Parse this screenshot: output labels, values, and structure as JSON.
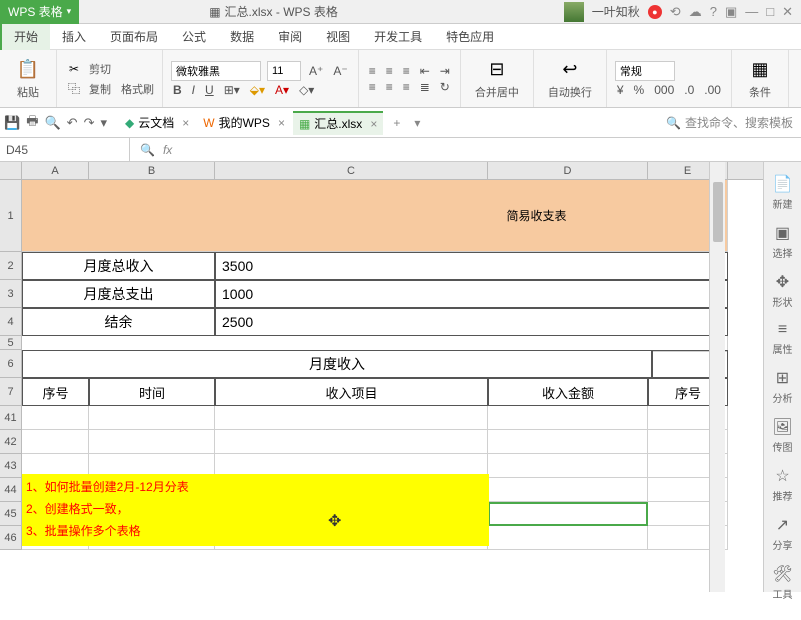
{
  "titlebar": {
    "app": "WPS 表格",
    "doc": "汇总.xlsx - WPS 表格",
    "user": "一叶知秋"
  },
  "menu": [
    "开始",
    "插入",
    "页面布局",
    "公式",
    "数据",
    "审阅",
    "视图",
    "开发工具",
    "特色应用"
  ],
  "ribbon": {
    "paste": "粘贴",
    "cut": "剪切",
    "copy": "复制",
    "format_painter": "格式刷",
    "font": "微软雅黑",
    "size": "11",
    "merge": "合并居中",
    "wrap": "自动换行",
    "num_format": "常规",
    "cond": "条件"
  },
  "tabs": {
    "cloud": "云文档",
    "my": "我的WPS",
    "file": "汇总.xlsx",
    "search": "查找命令、搜索模板"
  },
  "fx": {
    "name": "D45"
  },
  "cols": [
    "A",
    "B",
    "C",
    "D",
    "E"
  ],
  "sheet": {
    "title": "简易收支表",
    "r2_label": "月度总收入",
    "r2_val": "3500",
    "r3_label": "月度总支出",
    "r3_val": "1000",
    "r4_label": "结余",
    "r4_val": "2500",
    "r6": "月度收入",
    "h7": {
      "a": "序号",
      "b": "时间",
      "c": "收入项目",
      "d": "收入金额",
      "e": "序号"
    }
  },
  "rows_left": [
    "1",
    "2",
    "3",
    "4",
    "5",
    "6",
    "7",
    "41",
    "42",
    "43",
    "44",
    "45",
    "46"
  ],
  "note": {
    "l1": "1、如何批量创建2月-12月分表",
    "l2": "2、创建格式一致，",
    "l3": "3、批量操作多个表格"
  },
  "rpane": [
    {
      "ico": "📄",
      "t": "新建"
    },
    {
      "ico": "▣",
      "t": "选择"
    },
    {
      "ico": "✥",
      "t": "形状"
    },
    {
      "ico": "≡",
      "t": "属性"
    },
    {
      "ico": "⊞",
      "t": "分析"
    },
    {
      "ico": "🖼",
      "t": "传图"
    },
    {
      "ico": "☆",
      "t": "推荐"
    },
    {
      "ico": "↗",
      "t": "分享"
    },
    {
      "ico": "🛠",
      "t": "工具"
    }
  ]
}
